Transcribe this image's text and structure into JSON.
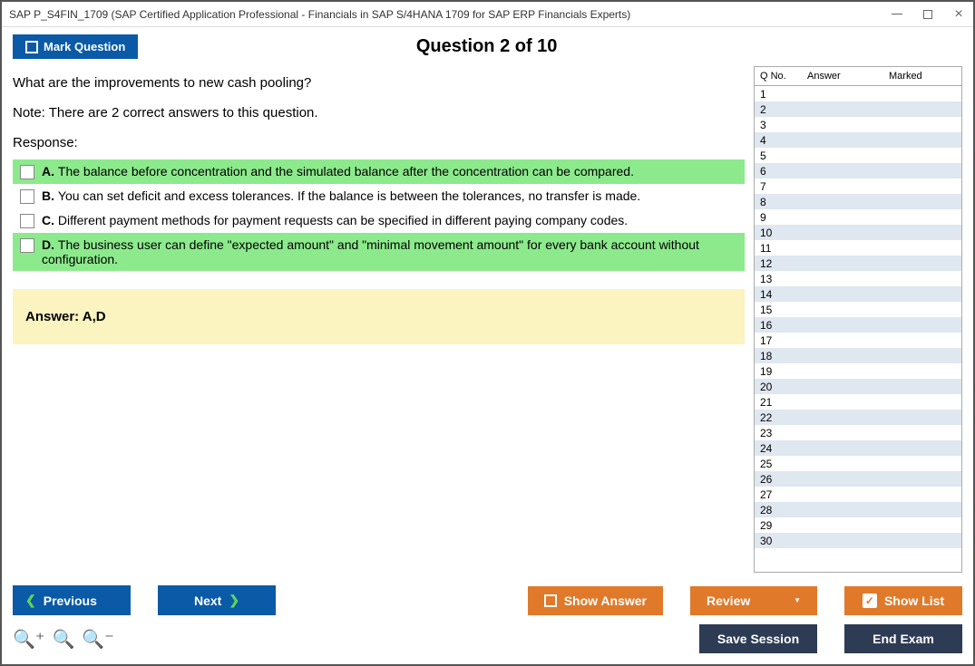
{
  "window": {
    "title": "SAP P_S4FIN_1709 (SAP Certified Application Professional - Financials in SAP S/4HANA 1709 for SAP ERP Financials Experts)"
  },
  "header": {
    "mark_label": "Mark Question",
    "counter": "Question 2 of 10"
  },
  "question": {
    "text": "What are the improvements to new cash pooling?",
    "note": "Note: There are 2 correct answers to this question.",
    "response_label": "Response:",
    "choices": [
      {
        "letter": "A.",
        "text": "The balance before concentration and the simulated balance after the concentration can be compared.",
        "correct": true
      },
      {
        "letter": "B.",
        "text": "You can set deficit and excess tolerances. If the balance is between the tolerances, no transfer is made.",
        "correct": false
      },
      {
        "letter": "C.",
        "text": "Different payment methods for payment requests can be specified in different paying company codes.",
        "correct": false
      },
      {
        "letter": "D.",
        "text": "The business user can define \"expected amount\" and \"minimal movement amount\" for every bank account without configuration.",
        "correct": true
      }
    ],
    "answer_label": "Answer: A,D"
  },
  "nav": {
    "col_q": "Q No.",
    "col_a": "Answer",
    "col_m": "Marked",
    "rows": [
      1,
      2,
      3,
      4,
      5,
      6,
      7,
      8,
      9,
      10,
      11,
      12,
      13,
      14,
      15,
      16,
      17,
      18,
      19,
      20,
      21,
      22,
      23,
      24,
      25,
      26,
      27,
      28,
      29,
      30
    ]
  },
  "buttons": {
    "previous": "Previous",
    "next": "Next",
    "show_answer": "Show Answer",
    "review": "Review",
    "show_list": "Show List",
    "save_session": "Save Session",
    "end_exam": "End Exam"
  }
}
